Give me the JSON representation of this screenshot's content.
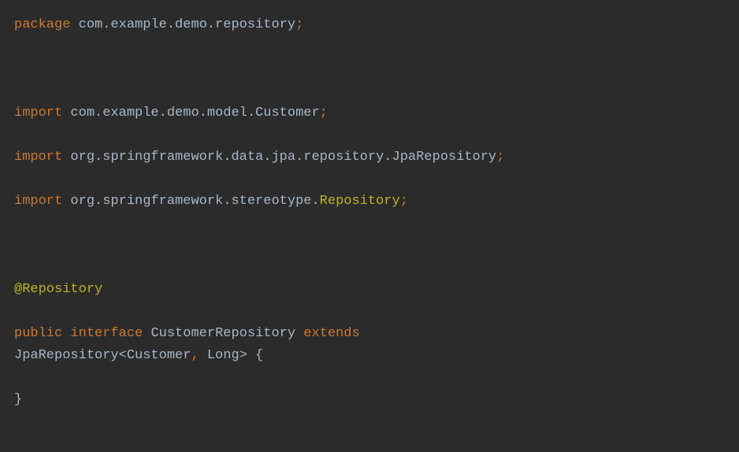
{
  "code": {
    "line1": {
      "package_kw": "package",
      "package_name": " com.example.demo.repository",
      "semi": ";"
    },
    "line2": {
      "import_kw": "import",
      "import_name": " com.example.demo.model.Customer",
      "semi": ";"
    },
    "line3": {
      "import_kw": "import",
      "import_name": " org.springframework.data.jpa.repository.JpaRepository",
      "semi": ";"
    },
    "line4": {
      "import_kw": "import",
      "import_name": " org.springframework.stereotype.",
      "repository_class": "Repository",
      "semi": ";"
    },
    "line5": {
      "annotation": "@Repository"
    },
    "line6": {
      "public_kw": "public",
      "space1": " ",
      "interface_kw": "interface",
      "space2": " ",
      "interface_name": "CustomerRepository",
      "space3": " ",
      "extends_kw": "extends"
    },
    "line7": {
      "base_class": "JpaRepository<Customer",
      "comma": ",",
      "long_type": " Long> {"
    },
    "line8": {
      "brace": "}"
    }
  }
}
